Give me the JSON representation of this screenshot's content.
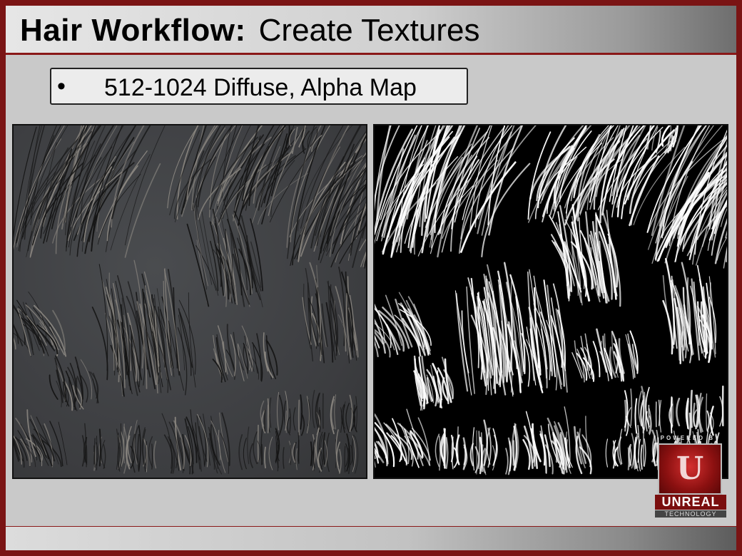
{
  "slide": {
    "title_bold": "Hair Workflow:",
    "title_regular": "Create Textures",
    "bullet_symbol": "•",
    "bullet_text": "512-1024 Diffuse, Alpha Map"
  },
  "logo": {
    "powered_by": "POWERED BY",
    "emblem_letter": "U",
    "name": "UNREAL",
    "sub": "TECHNOLOGY"
  },
  "colors": {
    "frame": "#7a1414",
    "accent_line": "#8a1818",
    "diffuse_background": "#3c3d40",
    "alpha_background": "#000000",
    "alpha_strands": "#ffffff"
  }
}
